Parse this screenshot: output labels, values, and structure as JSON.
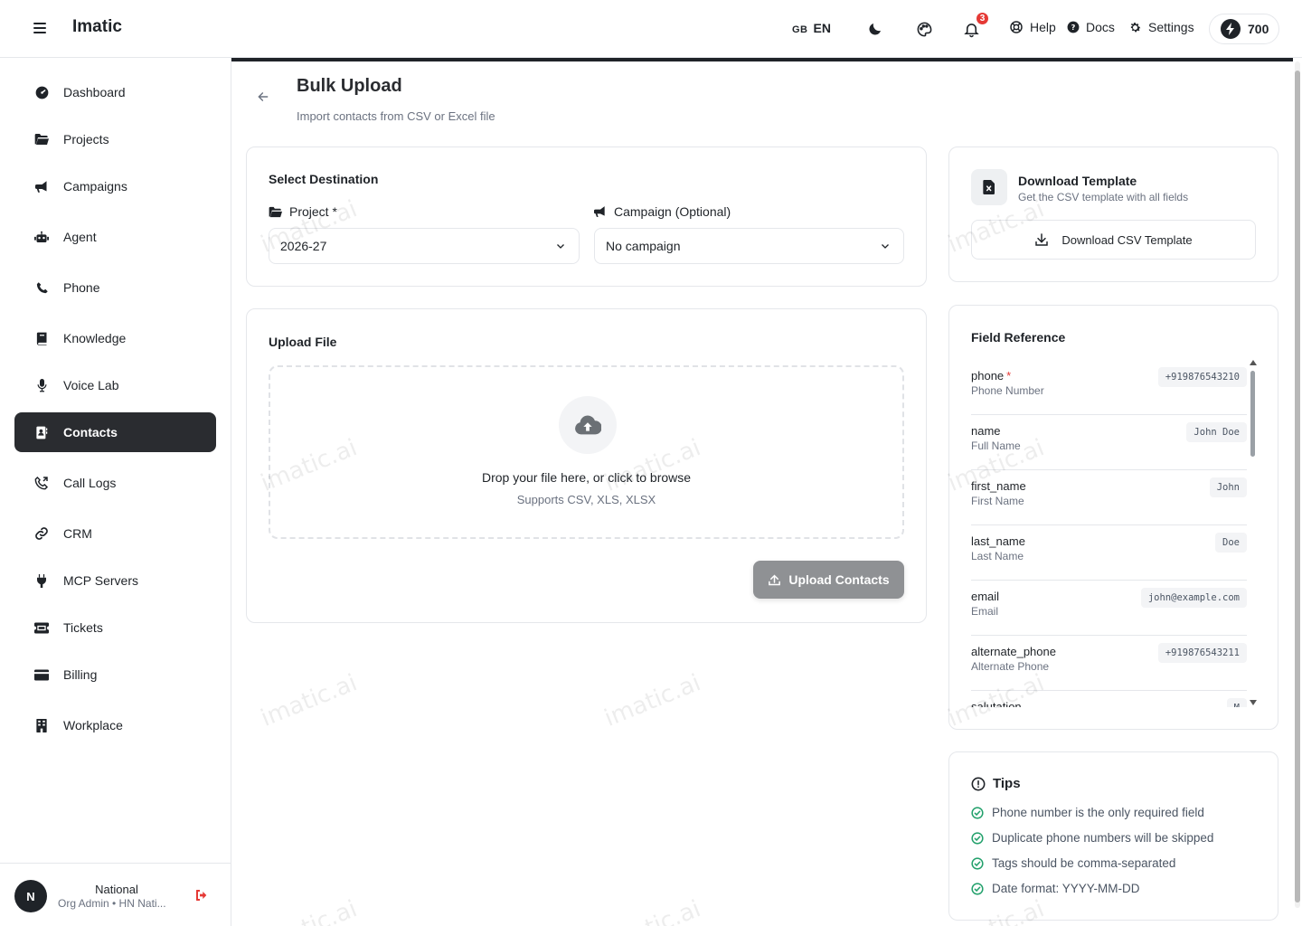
{
  "app": {
    "brand": "Imatic"
  },
  "topbar": {
    "lang_flag": "GB",
    "lang_code": "EN",
    "notification_count": "3",
    "help_label": "Help",
    "docs_label": "Docs",
    "settings_label": "Settings",
    "credits": "700"
  },
  "sidebar": {
    "items": [
      {
        "label": "Dashboard",
        "icon": "dashboard-icon"
      },
      {
        "label": "Projects",
        "icon": "folder-icon"
      },
      {
        "label": "Campaigns",
        "icon": "megaphone-icon"
      },
      {
        "label": "Agent",
        "icon": "robot-icon"
      },
      {
        "label": "Phone",
        "icon": "phone-icon"
      },
      {
        "label": "Knowledge",
        "icon": "book-icon"
      },
      {
        "label": "Voice Lab",
        "icon": "microphone-icon"
      },
      {
        "label": "Contacts",
        "icon": "contacts-icon",
        "active": true
      },
      {
        "label": "Call Logs",
        "icon": "call-log-icon"
      },
      {
        "label": "CRM",
        "icon": "link-icon"
      },
      {
        "label": "MCP Servers",
        "icon": "plug-icon"
      },
      {
        "label": "Tickets",
        "icon": "ticket-icon"
      },
      {
        "label": "Billing",
        "icon": "credit-card-icon"
      },
      {
        "label": "Workplace",
        "icon": "building-icon"
      }
    ],
    "user": {
      "initial": "N",
      "name": "National",
      "role": "Org Admin • HN Nati..."
    }
  },
  "page": {
    "title": "Bulk Upload",
    "subtitle": "Import contacts from CSV or Excel file"
  },
  "destination": {
    "title": "Select Destination",
    "project_label": "Project *",
    "project_value": "2026-27",
    "campaign_label": "Campaign (Optional)",
    "campaign_value": "No campaign"
  },
  "upload": {
    "title": "Upload File",
    "drop_text": "Drop your file here, or click to browse",
    "supports": "Supports CSV, XLS, XLSX",
    "button": "Upload Contacts"
  },
  "template": {
    "title": "Download Template",
    "subtitle": "Get the CSV template with all fields",
    "button": "Download CSV Template"
  },
  "field_reference": {
    "title": "Field Reference",
    "fields": [
      {
        "name": "phone",
        "required": "*",
        "desc": "Phone Number",
        "example": "+919876543210"
      },
      {
        "name": "name",
        "required": "",
        "desc": "Full Name",
        "example": "John Doe"
      },
      {
        "name": "first_name",
        "required": "",
        "desc": "First Name",
        "example": "John"
      },
      {
        "name": "last_name",
        "required": "",
        "desc": "Last Name",
        "example": "Doe"
      },
      {
        "name": "email",
        "required": "",
        "desc": "Email",
        "example": "john@example.com"
      },
      {
        "name": "alternate_phone",
        "required": "",
        "desc": "Alternate Phone",
        "example": "+919876543211"
      },
      {
        "name": "salutation",
        "required": "",
        "desc": "",
        "example": "M"
      }
    ]
  },
  "tips": {
    "title": "Tips",
    "items": [
      "Phone number is the only required field",
      "Duplicate phone numbers will be skipped",
      "Tags should be comma-separated",
      "Date format: YYYY-MM-DD"
    ]
  },
  "watermark": "imatic.ai",
  "colors": {
    "accent": "#2a2c30",
    "danger": "#e53935",
    "success": "#22a06b",
    "disabled_button": "#8f9194"
  }
}
